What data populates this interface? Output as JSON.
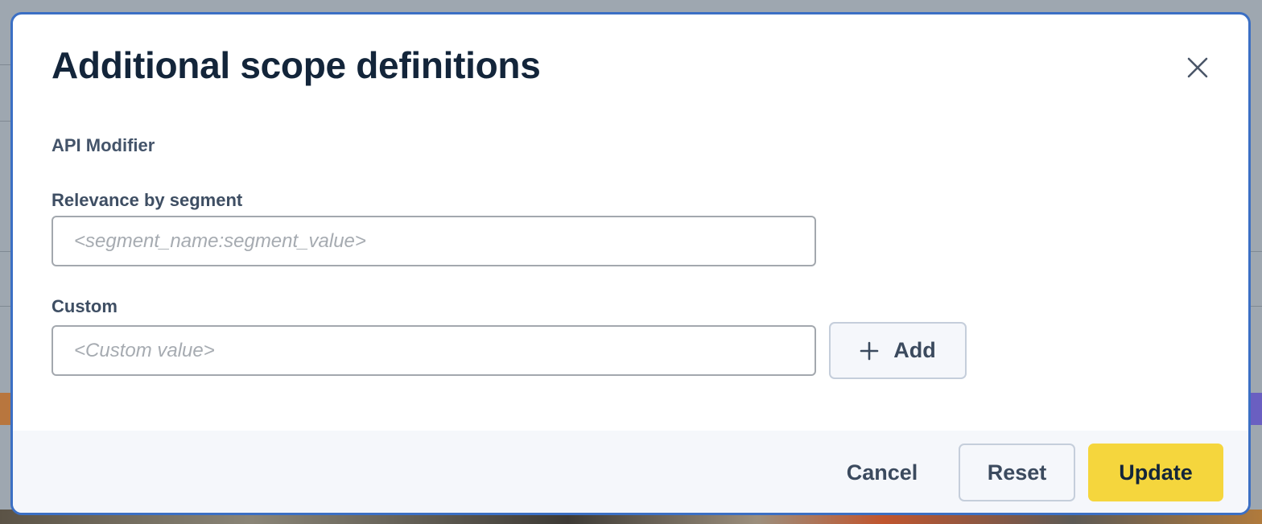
{
  "modal": {
    "title": "Additional scope definitions",
    "section_label": "API Modifier",
    "segment_field": {
      "label": "Relevance by segment",
      "placeholder": "<segment_name:segment_value>",
      "value": ""
    },
    "custom_field": {
      "label": "Custom",
      "placeholder": "<Custom value>",
      "value": ""
    },
    "add_button": {
      "label": "Add",
      "icon": "plus-icon"
    },
    "close_icon": "close-icon",
    "footer": {
      "cancel_label": "Cancel",
      "reset_label": "Reset",
      "update_label": "Update"
    }
  },
  "colors": {
    "accent_border": "#3b6fc4",
    "primary_button": "#f5d63d",
    "title_text": "#13253a",
    "footer_background": "#f5f7fb"
  }
}
